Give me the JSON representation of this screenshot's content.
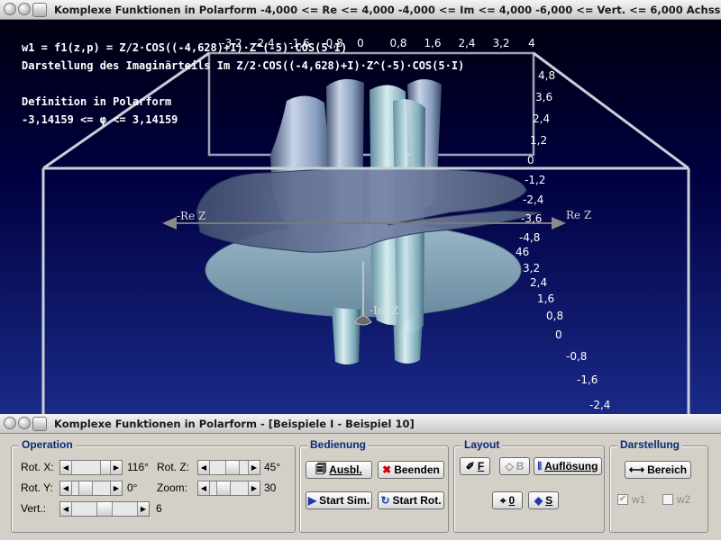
{
  "main_window": {
    "title": "Komplexe Funktionen in Polarform   -4,000 <= Re <= 4,000  -4,000 <= Im <= 4,000  -6,000 <= Vert. <= 6,000  Achsskalierungseinheiten: R..."
  },
  "viewport": {
    "info_lines": [
      "w1 = f1(z,p) = Z/2·COS((-4,628)+I)·Z^(-5)·COS(5·I)",
      "Darstellung des Imaginärteils Im Z/2·COS((-4,628)+I)·Z^(-5)·COS(5·I)",
      "",
      "Definition in Polarform",
      "-3,14159 <=  φ  <= 3,14159"
    ],
    "top_axis_ticks": [
      "-3,2",
      "-2,4",
      "-1,6",
      "-0,8",
      "0",
      "0,8",
      "1,6",
      "2,4",
      "3,2",
      "4"
    ],
    "right_axis_ticks_upper": [
      "4,8",
      "3,6",
      "2,4",
      "1,2",
      "0",
      "-1,2",
      "-2,4",
      "-3,6",
      "-4,8"
    ],
    "right_axis_ticks_lower": [
      "46",
      "3,2",
      "2,4",
      "1,6",
      "0,8",
      "0",
      "-0,8",
      "-1,6",
      "-2,4"
    ],
    "axis_labels": {
      "neg_re": "-Re Z",
      "pos_re": "Re Z",
      "im": "-Im Z"
    },
    "colors": {
      "background_top": "#000010",
      "background_bottom": "#1a2a88",
      "surface": "#b8c8d8",
      "frame": "#c8d0d8"
    }
  },
  "control_window": {
    "title": "Komplexe Funktionen in Polarform - [Beispiele I - Beispiel 10]"
  },
  "operation": {
    "title": "Operation",
    "rot_x_label": "Rot. X:",
    "rot_x_value": "116°",
    "rot_y_label": "Rot. Y:",
    "rot_y_value": "0°",
    "vert_label": "Vert.:",
    "vert_value": "6",
    "rot_z_label": "Rot. Z:",
    "rot_z_value": "45°",
    "zoom_label": "Zoom:",
    "zoom_value": "30"
  },
  "bedienung": {
    "title": "Bedienung",
    "ausbl_label": "Ausbl.",
    "beenden_label": "Beenden",
    "start_sim_label": "Start Sim.",
    "start_rot_label": "Start Rot."
  },
  "layout": {
    "title": "Layout",
    "f_label": "F",
    "b_label": "B",
    "aufloesung_label": "Auflösung",
    "zero_label": "0",
    "s_label": "S"
  },
  "darstellung": {
    "title": "Darstellung",
    "bereich_label": "Bereich",
    "w1_label": "w1",
    "w1_checked": true,
    "w2_label": "w2",
    "w2_checked": false
  }
}
